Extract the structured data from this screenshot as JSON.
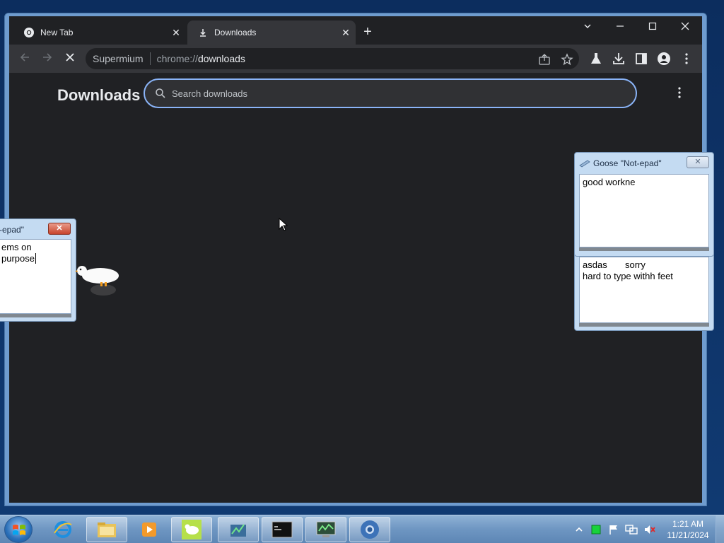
{
  "browser": {
    "tabs": [
      {
        "label": "New Tab",
        "active": false
      },
      {
        "label": "Downloads",
        "active": true
      }
    ],
    "window_controls": {
      "minimize": "–",
      "maximize": "☐",
      "close": "✕",
      "tab_search": "⌄"
    },
    "address": {
      "site_label": "Supermium",
      "scheme": "chrome://",
      "path": "downloads"
    },
    "page": {
      "title": "Downloads",
      "search_placeholder": "Search downloads"
    }
  },
  "notepad_right": {
    "title": "Goose \"Not-epad\"",
    "text": "good workne"
  },
  "notepad_right_lower": {
    "line1": "asdas       sorry",
    "line2": "hard to type withh feet"
  },
  "notepad_left": {
    "title": "-epad\"",
    "text": "ems on purpose"
  },
  "taskbar": {
    "apps": [
      "start-orb",
      "internet-explorer",
      "file-explorer",
      "media-player",
      "goose-app",
      "task-manager",
      "cmd",
      "system-monitor",
      "supermium"
    ],
    "clock_time": "1:21 AM",
    "clock_date": "11/21/2024"
  }
}
